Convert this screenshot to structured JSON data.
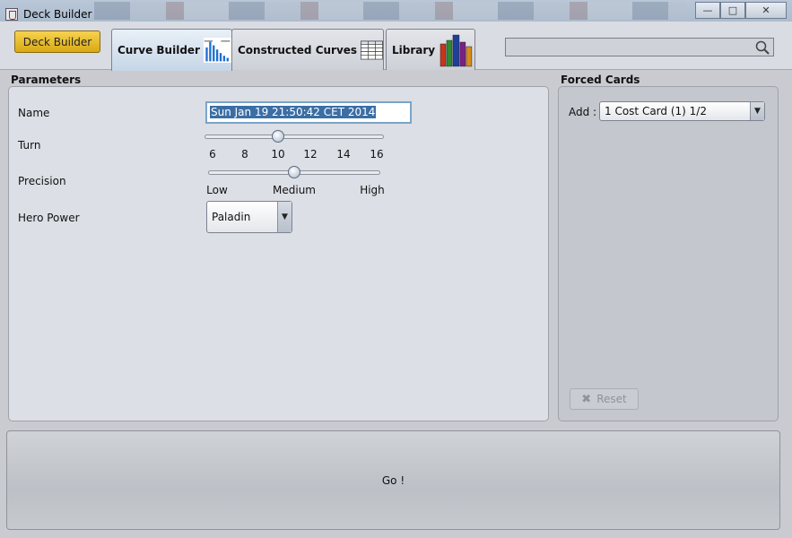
{
  "window": {
    "title": "Deck Builder"
  },
  "toolbar": {
    "deck_builder_button": "Deck Builder",
    "tabs": [
      {
        "label": "Curve Builder",
        "icon": "bar-chart-icon",
        "active": true
      },
      {
        "label": "Constructed Curves",
        "icon": "table-icon",
        "active": false
      },
      {
        "label": "Library",
        "icon": "books-icon",
        "active": false
      }
    ],
    "search": {
      "value": "",
      "icon": "search-icon"
    }
  },
  "parameters": {
    "title": "Parameters",
    "name": {
      "label": "Name",
      "value": "Sun Jan 19 21:50:42 CET 2014"
    },
    "turn": {
      "label": "Turn",
      "ticks": [
        "6",
        "8",
        "10",
        "12",
        "14",
        "16"
      ],
      "value": 10,
      "min": 6,
      "max": 16
    },
    "precision": {
      "label": "Precision",
      "ticks": [
        "Low",
        "Medium",
        "High"
      ],
      "value": "Medium"
    },
    "hero_power": {
      "label": "Hero Power",
      "value": "Paladin"
    }
  },
  "forced_cards": {
    "title": "Forced Cards",
    "add_label": "Add :",
    "add_value": "1 Cost Card (1) 1/2",
    "reset_label": "Reset"
  },
  "go_button": "Go !",
  "colors": {
    "accent_button": "#e1b52a",
    "selection": "#3a6ea5"
  }
}
